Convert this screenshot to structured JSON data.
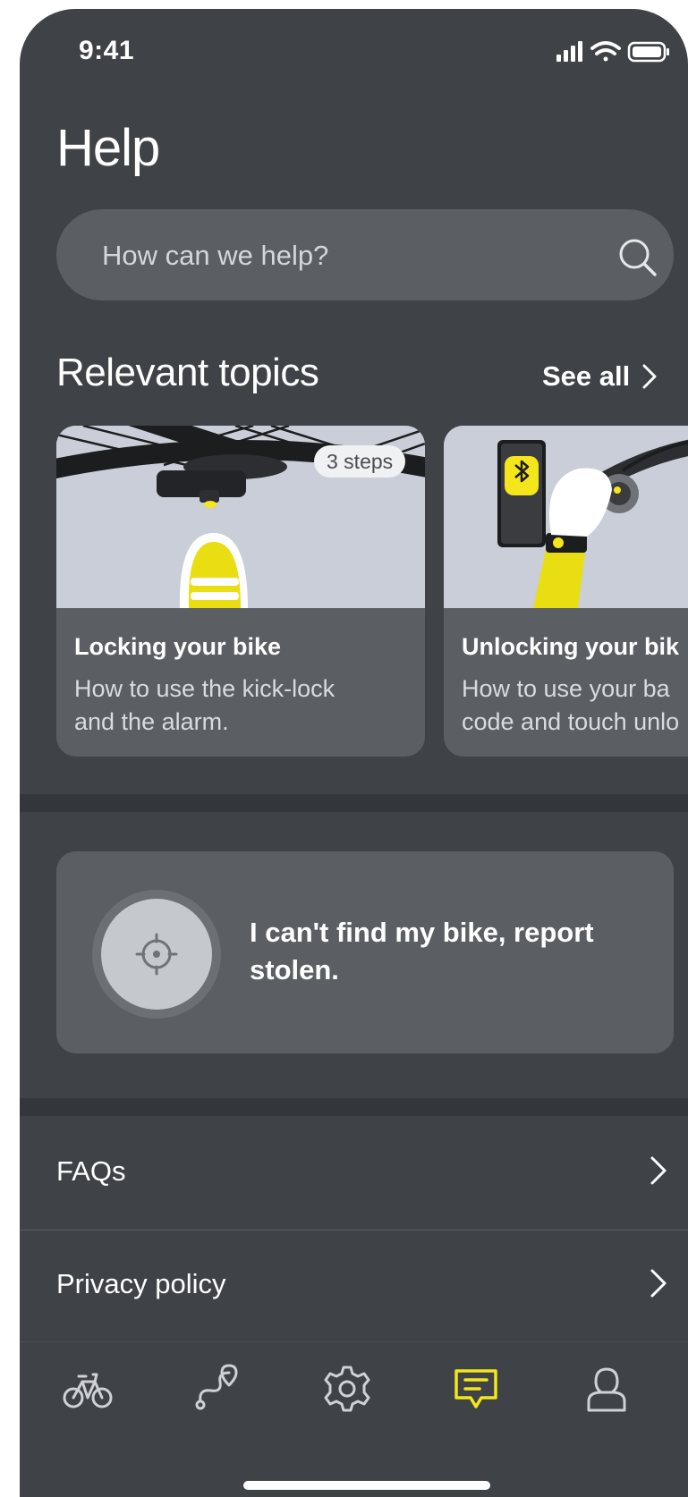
{
  "status_bar": {
    "time": "9:41"
  },
  "page": {
    "title": "Help"
  },
  "search": {
    "placeholder": "How can we help?"
  },
  "topics": {
    "heading": "Relevant topics",
    "see_all": "See all",
    "cards": [
      {
        "badge": "3 steps",
        "title": "Locking your bike",
        "description": "How to use the kick-lock\nand the alarm."
      },
      {
        "title": "Unlocking your bik",
        "description": "How to use your ba\ncode and touch unlo"
      }
    ]
  },
  "report": {
    "label": "I can't find my bike, report stolen."
  },
  "links": [
    {
      "label": "FAQs"
    },
    {
      "label": "Privacy policy"
    }
  ],
  "tab_bar": {
    "items": [
      {
        "icon": "bike-icon",
        "active": false
      },
      {
        "icon": "route-icon",
        "active": false
      },
      {
        "icon": "settings-icon",
        "active": false
      },
      {
        "icon": "chat-icon",
        "active": true
      },
      {
        "icon": "profile-icon",
        "active": false
      }
    ]
  },
  "colors": {
    "accent": "#f4e61a",
    "background": "#3f4246",
    "card": "#5b5e63"
  }
}
